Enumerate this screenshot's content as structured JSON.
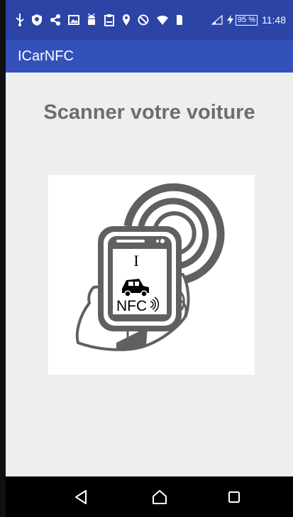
{
  "status_bar": {
    "battery_percent": "95 %",
    "time": "11:48",
    "icons": [
      "usb-icon",
      "shield-icon",
      "share-icon",
      "image-icon",
      "android-icon",
      "clipboard-icon",
      "location-icon",
      "do-not-disturb-icon",
      "wifi-icon",
      "sim-icon",
      "signal-icon",
      "charging-icon"
    ]
  },
  "app_bar": {
    "title": "ICarNFC"
  },
  "main": {
    "heading": "Scanner votre voiture",
    "illustration": {
      "letter": "I",
      "label": "NFC"
    }
  },
  "navigation": {
    "icons": [
      "back-icon",
      "home-icon",
      "recent-apps-icon"
    ]
  },
  "colors": {
    "status_bar": "#2c44a6",
    "app_bar": "#3451b9",
    "background": "#eeeeee",
    "heading": "#6d6d6d",
    "illustration": "#606060"
  }
}
